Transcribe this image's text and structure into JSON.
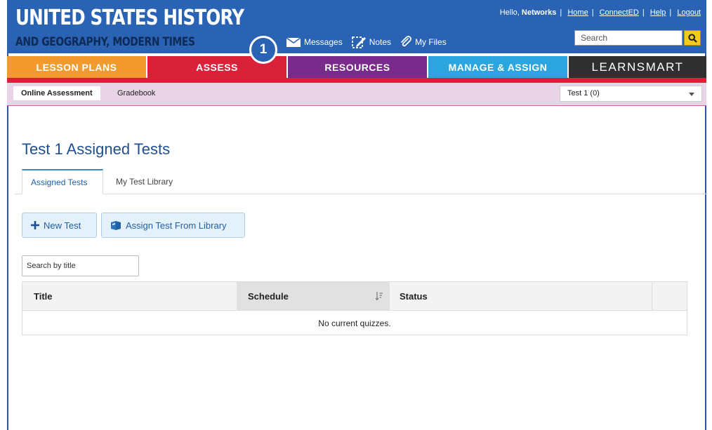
{
  "header": {
    "title": "UNITED STATES HISTORY",
    "subtitle": "AND GEOGRAPHY, MODERN TIMES",
    "greeting": "Hello,",
    "user_name": "Networks",
    "links": [
      "Home",
      "ConnectED",
      "Help",
      "Logout"
    ],
    "search_placeholder": "Search",
    "tools": {
      "messages": "Messages",
      "notes": "Notes",
      "files": "My Files"
    },
    "callout_number": "1"
  },
  "nav": {
    "lesson_plans": "LESSON PLANS",
    "assess": "ASSESS",
    "resources": "RESOURCES",
    "manage_assign": "MANAGE & ASSIGN",
    "learnsmart": "LEARNSMART"
  },
  "subnav": {
    "online_assessment": "Online Assessment",
    "gradebook": "Gradebook",
    "selected_test": "Test 1 (0)"
  },
  "main": {
    "page_title": "Test 1 Assigned Tests",
    "tabs": [
      "Assigned Tests",
      "My Test Library"
    ],
    "buttons": {
      "new_test": "New Test",
      "assign_from_library": "Assign Test From Library"
    },
    "search_placeholder": "Search by title",
    "table": {
      "columns": [
        "Title",
        "Schedule",
        "Status"
      ],
      "empty_message": "No current quizzes."
    }
  },
  "colors": {
    "header_blue": "#2a62b4",
    "lesson_orange": "#f29a2e",
    "assess_red": "#d9223a",
    "resources_purple": "#7a2a8c",
    "manage_cyan": "#2aa5df",
    "learnsmart_dark": "#2f2f2f",
    "search_yellow": "#f2cb1d"
  }
}
